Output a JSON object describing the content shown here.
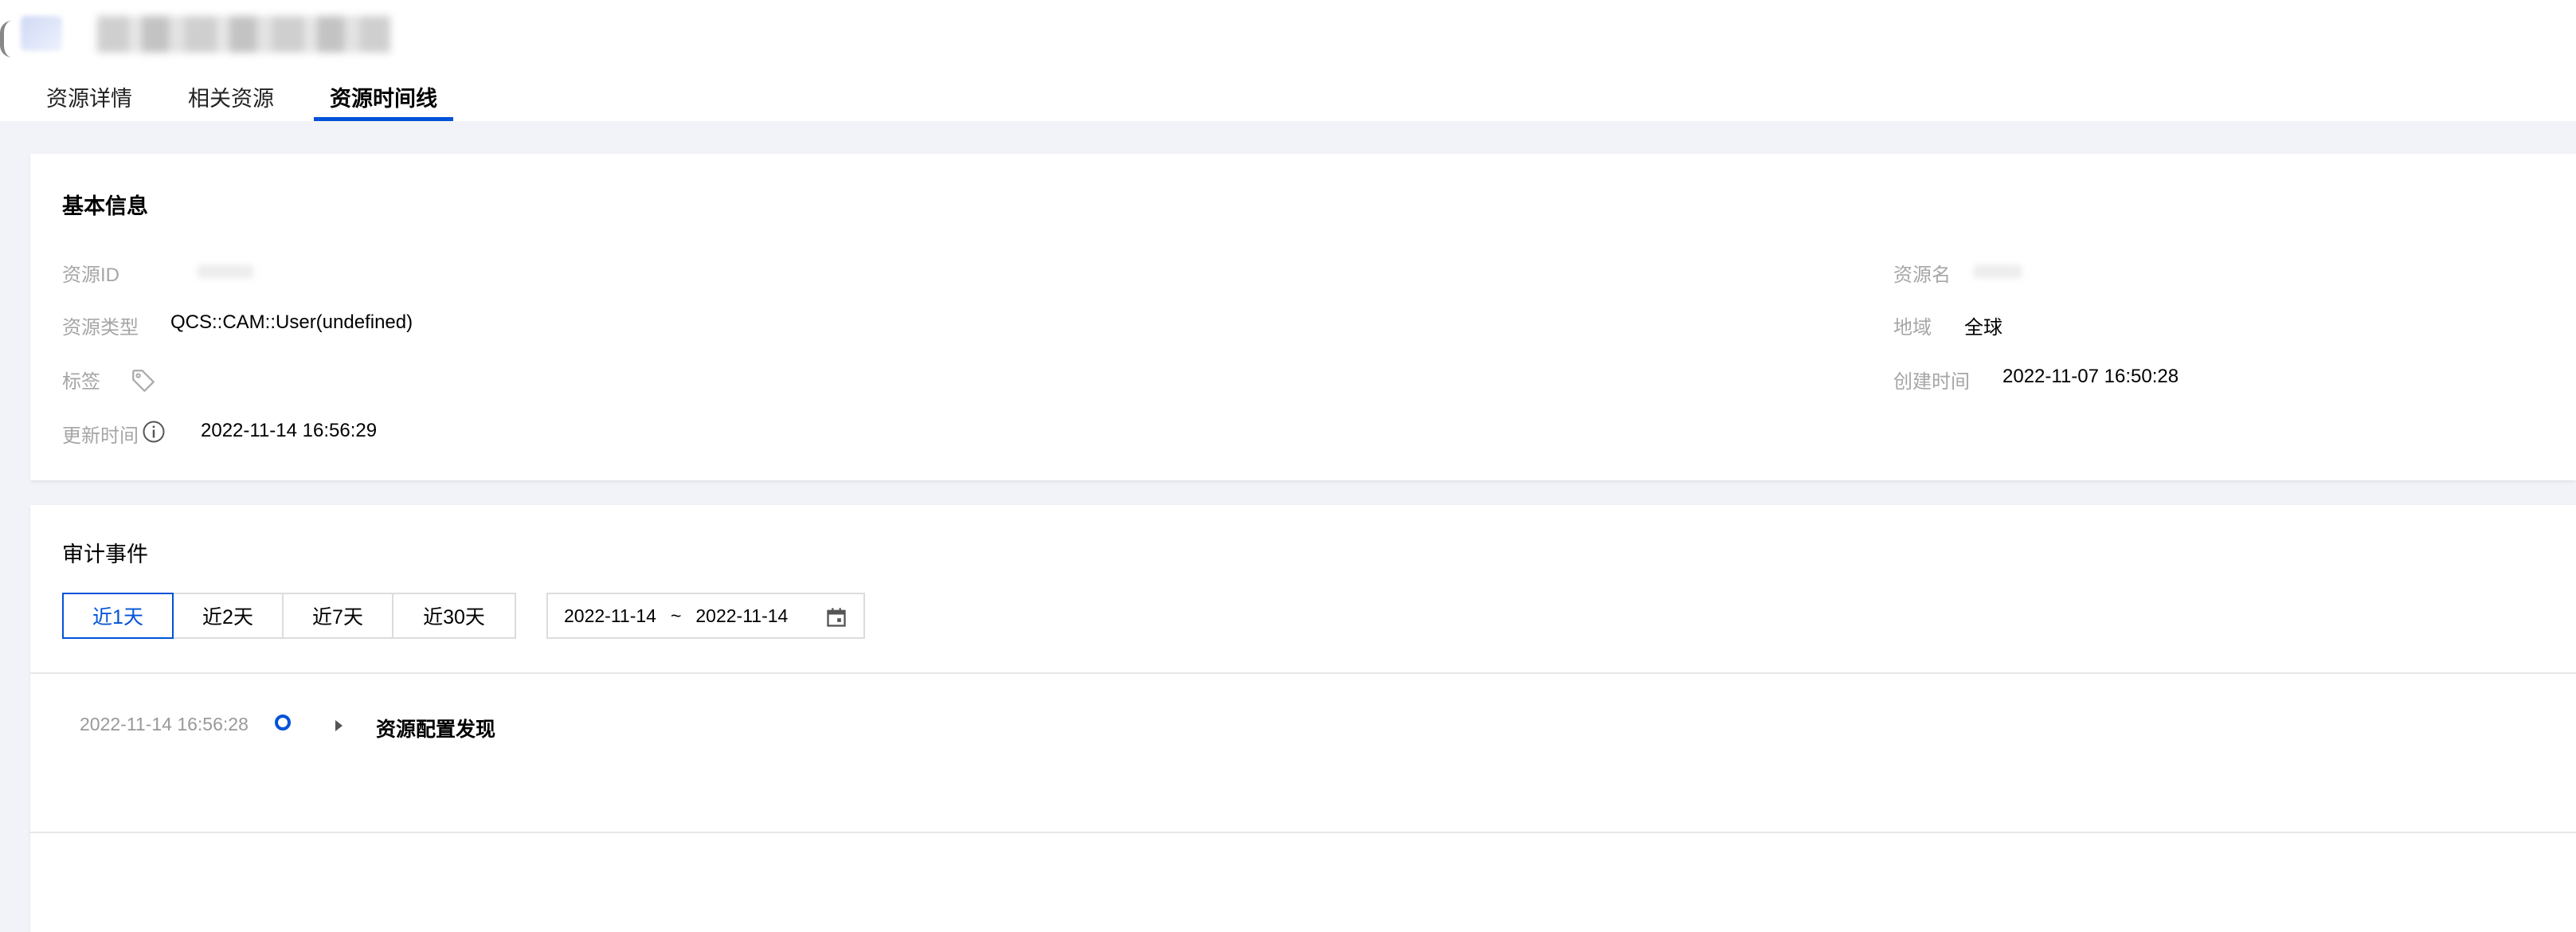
{
  "tabs": [
    {
      "label": "资源详情"
    },
    {
      "label": "相关资源"
    },
    {
      "label": "资源时间线"
    }
  ],
  "basic_info": {
    "title": "基本信息",
    "resource_id_label": "资源ID",
    "resource_type_label": "资源类型",
    "resource_type_value": "QCS::CAM::User(undefined)",
    "tags_label": "标签",
    "updated_label": "更新时间",
    "updated_value": "2022-11-14 16:56:29",
    "resource_name_label": "资源名",
    "region_label": "地域",
    "region_value": "全球",
    "created_label": "创建时间",
    "created_value": "2022-11-07 16:50:28"
  },
  "audit": {
    "title": "审计事件",
    "ranges": [
      {
        "label": "近1天"
      },
      {
        "label": "近2天"
      },
      {
        "label": "近7天"
      },
      {
        "label": "近30天"
      }
    ],
    "date_start": "2022-11-14",
    "date_sep": "~",
    "date_end": "2022-11-14",
    "event": {
      "time": "2022-11-14 16:56:28",
      "name": "资源配置发现"
    }
  },
  "colors": {
    "accent": "#0052d9",
    "background": "#f2f3f8",
    "label_gray": "#a6a6a6"
  },
  "icons": [
    "back-icon",
    "tag-icon",
    "info-icon",
    "calendar-icon",
    "timeline-dot-icon",
    "caret-right-icon"
  ]
}
